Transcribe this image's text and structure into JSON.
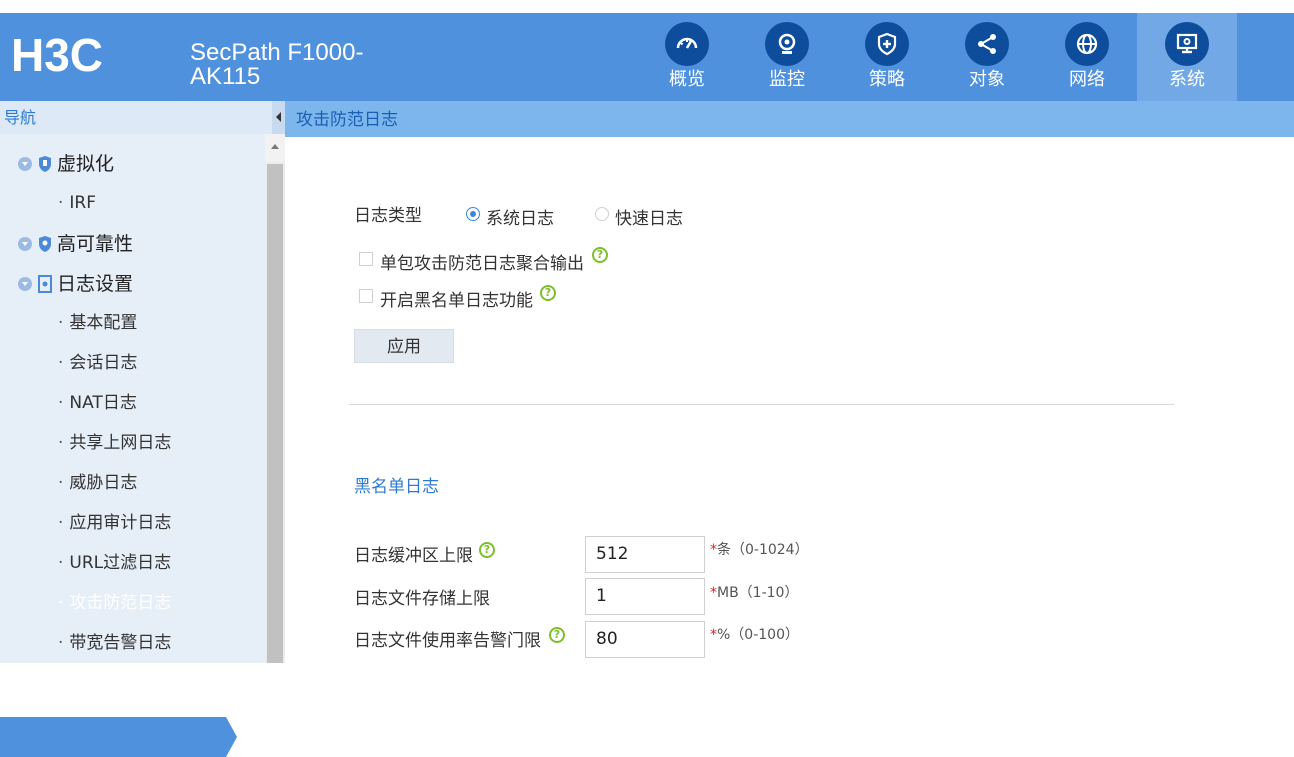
{
  "header": {
    "logo": "H3C",
    "product_line1": "SecPath F1000-",
    "product_line2": "AK115",
    "nav": [
      {
        "label": "概览",
        "icon": "dashboard-icon",
        "active": false
      },
      {
        "label": "监控",
        "icon": "webcam-icon",
        "active": false
      },
      {
        "label": "策略",
        "icon": "shield-plus-icon",
        "active": false
      },
      {
        "label": "对象",
        "icon": "share-icon",
        "active": false
      },
      {
        "label": "网络",
        "icon": "globe-icon",
        "active": false
      },
      {
        "label": "系统",
        "icon": "monitor-gear-icon",
        "active": true
      }
    ]
  },
  "sidebar": {
    "title": "导航",
    "groups": [
      {
        "label": "虚拟化",
        "items": [
          "IRF"
        ]
      },
      {
        "label": "高可靠性",
        "items": []
      },
      {
        "label": "日志设置",
        "items": [
          "基本配置",
          "会话日志",
          "NAT日志",
          "共享上网日志",
          "威胁日志",
          "应用审计日志",
          "URL过滤日志",
          "攻击防范日志",
          "带宽告警日志"
        ]
      }
    ],
    "active_item": "攻击防范日志"
  },
  "breadcrumb": "攻击防范日志",
  "form": {
    "log_type_label": "日志类型",
    "log_type_options": [
      "系统日志",
      "快速日志"
    ],
    "log_type_selected": "系统日志",
    "checkbox_aggregate": "单包攻击防范日志聚合输出",
    "checkbox_blacklist": "开启黑名单日志功能",
    "apply_label": "应用",
    "section_blacklist": "黑名单日志",
    "fields": [
      {
        "label": "日志缓冲区上限",
        "value": "512",
        "hint": "条（0-1024）",
        "help": true
      },
      {
        "label": "日志文件存储上限",
        "value": "1",
        "hint": "MB（1-10）",
        "help": false
      },
      {
        "label": "日志文件使用率告警门限",
        "value": "80",
        "hint": "%（0-100）",
        "help": true
      }
    ]
  },
  "colors": {
    "header_bg": "#4f91dd",
    "active_nav": "#72a8e6",
    "icon_circle": "#0e4d9c",
    "breadcrumb_bg": "#7cb6ec",
    "sidebar_bg": "#e6eef8",
    "help_green": "#7dbf2a"
  }
}
